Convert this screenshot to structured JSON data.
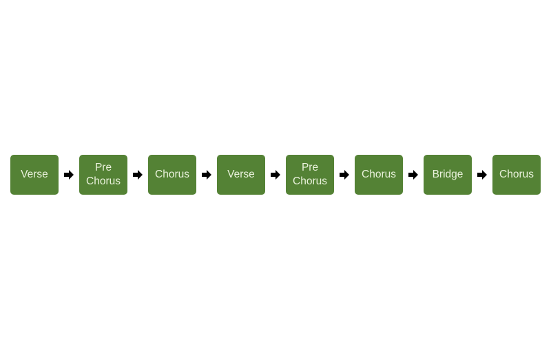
{
  "diagram": {
    "type": "song-structure-flow",
    "box_color": "#548235",
    "text_color": "#eaf2dc",
    "arrow_color": "#000000",
    "sections": [
      {
        "label": "Verse"
      },
      {
        "label": "Pre Chorus",
        "lines": [
          "Pre",
          "Chorus"
        ]
      },
      {
        "label": "Chorus"
      },
      {
        "label": "Verse"
      },
      {
        "label": "Pre Chorus",
        "lines": [
          "Pre",
          "Chorus"
        ]
      },
      {
        "label": "Chorus"
      },
      {
        "label": "Bridge"
      },
      {
        "label": "Chorus"
      }
    ],
    "connector_icon": "right-arrow-icon"
  }
}
